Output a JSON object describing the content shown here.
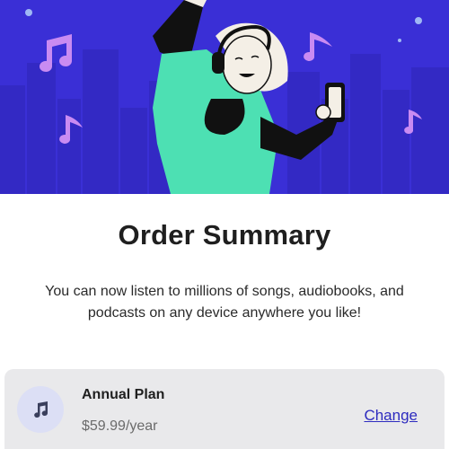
{
  "summary": {
    "title": "Order Summary",
    "description": "You can now listen to millions of songs, audiobooks, and podcasts on any device anywhere you like!"
  },
  "plan": {
    "name": "Annual Plan",
    "price": "$59.99/year",
    "change_label": "Change",
    "icon": "music-note-icon"
  },
  "colors": {
    "hero_background": "#3a2fd6",
    "accent": "#2d2bbf",
    "card_background": "#e9e9eb",
    "note_color": "#c98bf2"
  }
}
